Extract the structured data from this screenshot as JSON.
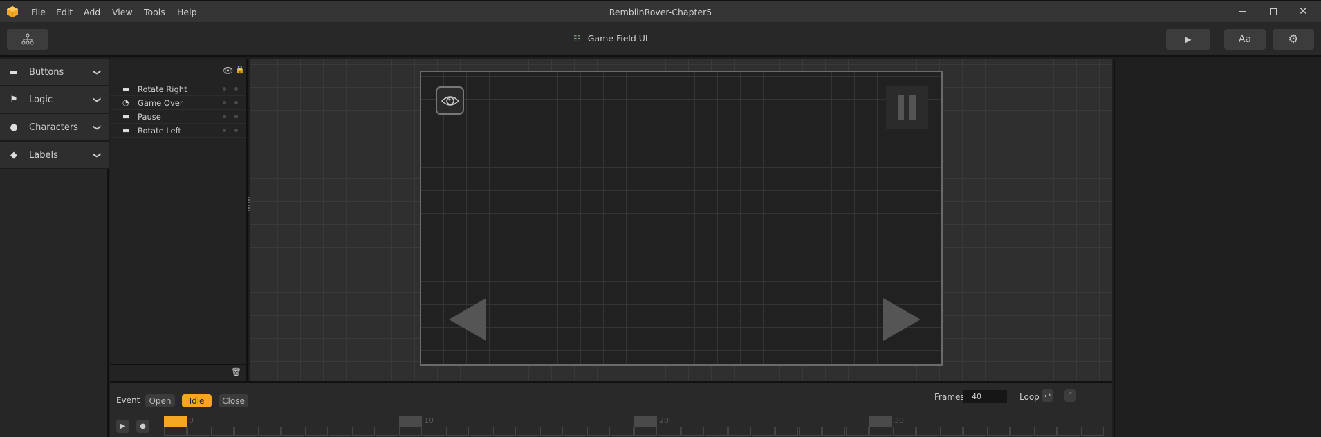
{
  "window": {
    "title": "RemblinRover-Chapter5",
    "controls": [
      "minimize",
      "maximize",
      "close"
    ]
  },
  "menu": [
    "File",
    "Edit",
    "Add",
    "View",
    "Tools",
    "Help"
  ],
  "toolbar": {
    "scene_title": "Game Field UI",
    "aa_label": "Aa"
  },
  "sidebar": {
    "items": [
      {
        "label": "Buttons",
        "icon": "button-icon"
      },
      {
        "label": "Logic",
        "icon": "logic-icon"
      },
      {
        "label": "Characters",
        "icon": "person-icon"
      },
      {
        "label": "Labels",
        "icon": "tag-icon"
      }
    ]
  },
  "layers": {
    "items": [
      {
        "label": "Rotate Right",
        "icon": "button-icon"
      },
      {
        "label": "Game Over",
        "icon": "timer-icon"
      },
      {
        "label": "Pause",
        "icon": "button-icon"
      },
      {
        "label": "Rotate Left",
        "icon": "button-icon"
      }
    ]
  },
  "timeline": {
    "event_label": "Event",
    "events": [
      {
        "label": "Open",
        "active": false
      },
      {
        "label": "Idle",
        "active": true
      },
      {
        "label": "Close",
        "active": false
      }
    ],
    "frames_label": "Frames",
    "frames_value": "40",
    "loop_label": "Loop",
    "frame_count": 40,
    "current_frame": 0,
    "markers": [
      "0",
      "10",
      "20",
      "30"
    ]
  },
  "colors": {
    "accent": "#f5a623"
  }
}
